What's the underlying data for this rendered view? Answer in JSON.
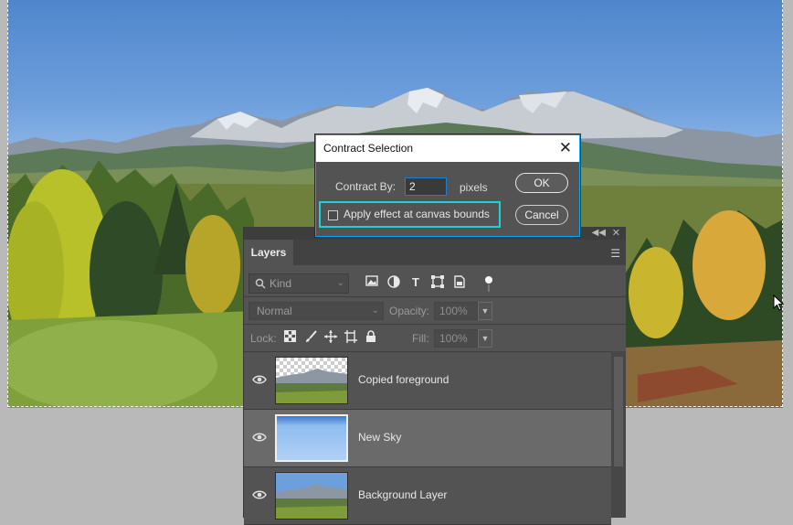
{
  "dialog": {
    "title": "Contract Selection",
    "contract_by_label": "Contract By:",
    "contract_by_value": "2",
    "unit_label": "pixels",
    "ok_label": "OK",
    "cancel_label": "Cancel",
    "apply_label": "Apply effect at canvas bounds",
    "apply_checked": false,
    "highlight_color": "#20d0d8"
  },
  "layers_panel": {
    "tab_label": "Layers",
    "filter": {
      "placeholder": "Kind",
      "icons": [
        "image-icon",
        "adjustment-icon",
        "type-icon",
        "shape-icon",
        "smart-object-icon",
        "filter-toggle-icon"
      ]
    },
    "blend_mode": "Normal",
    "opacity_label": "Opacity:",
    "opacity_value": "100%",
    "lock_label": "Lock:",
    "lock_icons": [
      "lock-transparent-icon",
      "lock-paint-icon",
      "lock-position-icon",
      "lock-artboard-icon",
      "lock-all-icon"
    ],
    "fill_label": "Fill:",
    "fill_value": "100%",
    "layers": [
      {
        "name": "Copied foreground",
        "visible": true,
        "selected": false
      },
      {
        "name": "New Sky",
        "visible": true,
        "selected": true
      },
      {
        "name": "Background Layer",
        "visible": true,
        "selected": false
      }
    ]
  },
  "colors": {
    "panel_bg": "#535353",
    "selected_row": "#6a6a6a",
    "sky_light": "#b9d4f2",
    "accent_blue": "#1e7fd0"
  }
}
